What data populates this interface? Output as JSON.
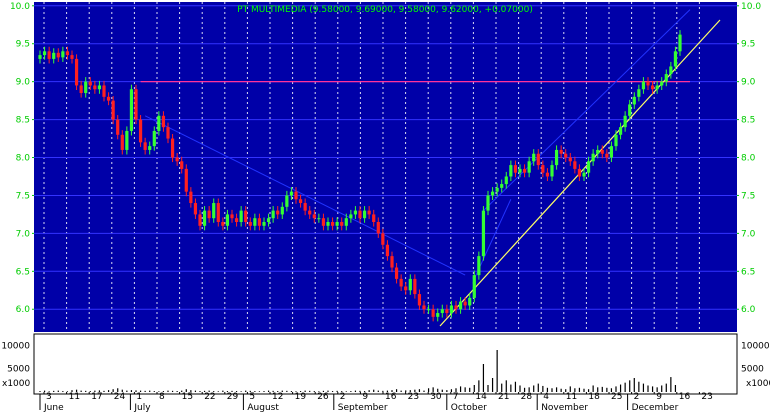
{
  "title": "PT MULTIMEDIA (9.58000, 9.69000, 9.58000, 9.62000, +0.07000)",
  "colors": {
    "background": "#0000a8",
    "grid_vertical": "#ffffff",
    "grid_horizontal": "#3333ff",
    "axis_text": "#00cc00",
    "title_text": "#00ff00",
    "candle_up": "#33ff33",
    "candle_down": "#ff2020",
    "resistance_line": "#ff3399",
    "support_trend": "#ffff66",
    "channel_lines": "#2233ff",
    "volume_bar": "#000000"
  },
  "chart_data": [
    {
      "type": "candlestick",
      "title": "PT MULTIMEDIA (9.58000, 9.69000, 9.58000, 9.62000, +0.07000)",
      "ylim": [
        5.7,
        10.05
      ],
      "yticks": [
        6.0,
        6.5,
        7.0,
        7.5,
        8.0,
        8.5,
        9.0,
        9.5,
        10.0
      ],
      "ytick_labels": [
        "6.0",
        "6.5",
        "7.0",
        "7.5",
        "8.0",
        "8.5",
        "9.0",
        "9.5",
        "10.0"
      ],
      "grid": true,
      "day_ticks": [
        "3",
        "11",
        "17",
        "24",
        "1",
        "8",
        "15",
        "22",
        "29",
        "5",
        "12",
        "19",
        "26",
        "2",
        "9",
        "16",
        "23",
        "30",
        "7",
        "14",
        "21",
        "28",
        "4",
        "11",
        "18",
        "25",
        "2",
        "9",
        "16",
        "23"
      ],
      "month_labels": [
        "June",
        "July",
        "August",
        "September",
        "October",
        "November",
        "December"
      ],
      "resistance_level": 9.0,
      "close": [
        9.35,
        9.4,
        9.3,
        9.38,
        9.32,
        9.4,
        9.35,
        9.3,
        8.95,
        8.85,
        9.0,
        8.95,
        8.9,
        8.95,
        8.8,
        8.75,
        8.5,
        8.3,
        8.1,
        8.35,
        8.9,
        8.5,
        8.2,
        8.1,
        8.15,
        8.35,
        8.55,
        8.4,
        8.25,
        8.0,
        7.95,
        7.85,
        7.55,
        7.4,
        7.25,
        7.1,
        7.3,
        7.2,
        7.4,
        7.15,
        7.1,
        7.25,
        7.2,
        7.15,
        7.3,
        7.15,
        7.1,
        7.2,
        7.1,
        7.15,
        7.2,
        7.3,
        7.25,
        7.35,
        7.5,
        7.55,
        7.45,
        7.4,
        7.3,
        7.25,
        7.2,
        7.2,
        7.1,
        7.15,
        7.1,
        7.15,
        7.1,
        7.2,
        7.25,
        7.3,
        7.2,
        7.3,
        7.25,
        7.15,
        7.0,
        6.85,
        6.7,
        6.55,
        6.4,
        6.3,
        6.25,
        6.4,
        6.2,
        6.05,
        6.0,
        6.0,
        5.9,
        5.95,
        6.0,
        5.95,
        6.05,
        6.0,
        6.1,
        6.05,
        6.15,
        6.45,
        6.7,
        7.3,
        7.5,
        7.55,
        7.6,
        7.65,
        7.75,
        7.9,
        7.8,
        7.85,
        7.8,
        7.95,
        8.05,
        7.9,
        7.8,
        7.75,
        7.9,
        8.1,
        8.05,
        8.0,
        7.95,
        7.85,
        7.75,
        7.8,
        7.95,
        8.05,
        8.1,
        8.05,
        8.0,
        8.15,
        8.3,
        8.4,
        8.55,
        8.7,
        8.8,
        8.9,
        9.0,
        8.95,
        8.9,
        8.95,
        9.0,
        9.1,
        9.2,
        9.4,
        9.62
      ],
      "volume": {
        "yticks": [
          5000,
          10000
        ],
        "ytick_labels": [
          "5000",
          "10000"
        ],
        "unit_label": "x1000",
        "values": [
          200,
          300,
          150,
          250,
          300,
          200,
          150,
          400,
          500,
          300,
          250,
          200,
          300,
          350,
          250,
          400,
          600,
          800,
          500,
          300,
          400,
          350,
          300,
          250,
          300,
          200,
          150,
          200,
          300,
          250,
          200,
          300,
          600,
          400,
          300,
          200,
          250,
          300,
          200,
          150,
          300,
          200,
          250,
          200,
          150,
          300,
          250,
          200,
          150,
          200,
          300,
          250,
          200,
          300,
          250,
          200,
          150,
          200,
          300,
          250,
          200,
          150,
          250,
          300,
          200,
          250,
          200,
          150,
          200,
          300,
          250,
          200,
          400,
          500,
          300,
          250,
          300,
          400,
          600,
          300,
          350,
          400,
          500,
          600,
          300,
          800,
          1000,
          700,
          500,
          400,
          600,
          800,
          1200,
          1000,
          900,
          1500,
          2500,
          6000,
          1500,
          3000,
          9000,
          1800,
          2500,
          1600,
          2200,
          1400,
          900,
          1000,
          1400,
          1800,
          1300,
          900,
          800,
          1000,
          700,
          600,
          1200,
          800,
          900,
          700,
          600,
          1400,
          1000,
          1100,
          900,
          800,
          1200,
          1600,
          2000,
          2500,
          3000,
          2200,
          1800,
          1400,
          1200,
          1000,
          1400,
          1800,
          3200,
          1500
        ]
      }
    }
  ]
}
